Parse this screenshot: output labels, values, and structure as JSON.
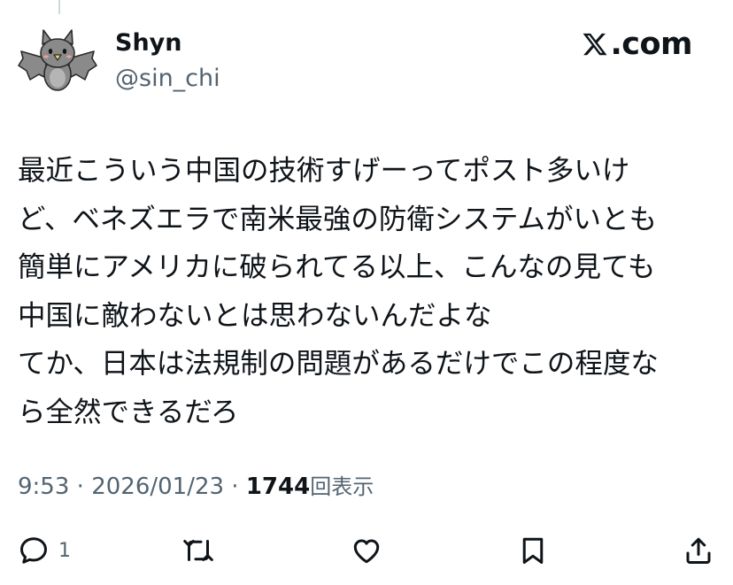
{
  "author": {
    "display_name": "Shyn",
    "handle": "@sin_chi",
    "avatar_icon": "bat-avatar"
  },
  "brand": {
    "label": ".com",
    "icon": "x-logo-icon"
  },
  "tweet": {
    "lines": [
      "最近こういう中国の技術すげーってポスト多いけ",
      "ど、ベネズエラで南米最強の防衛システムがいとも",
      "簡単にアメリカに破られてる以上、こんなの見ても",
      "中国に敵わないとは思わないんだよな",
      "てか、日本は法規制の問題があるだけでこの程度な",
      "ら全然できるだろ"
    ]
  },
  "meta": {
    "time": "9:53",
    "separator": " · ",
    "date": "2026/01/23",
    "views_count": "1744",
    "views_label": "回表示"
  },
  "actions": {
    "reply_count": "1",
    "reply_icon": "reply-icon",
    "repost_icon": "repost-icon",
    "like_icon": "heart-icon",
    "bookmark_icon": "bookmark-icon",
    "share_icon": "share-icon"
  },
  "colors": {
    "text": "#0f1419",
    "secondary": "#536471",
    "avatar_bat": "#808080"
  }
}
